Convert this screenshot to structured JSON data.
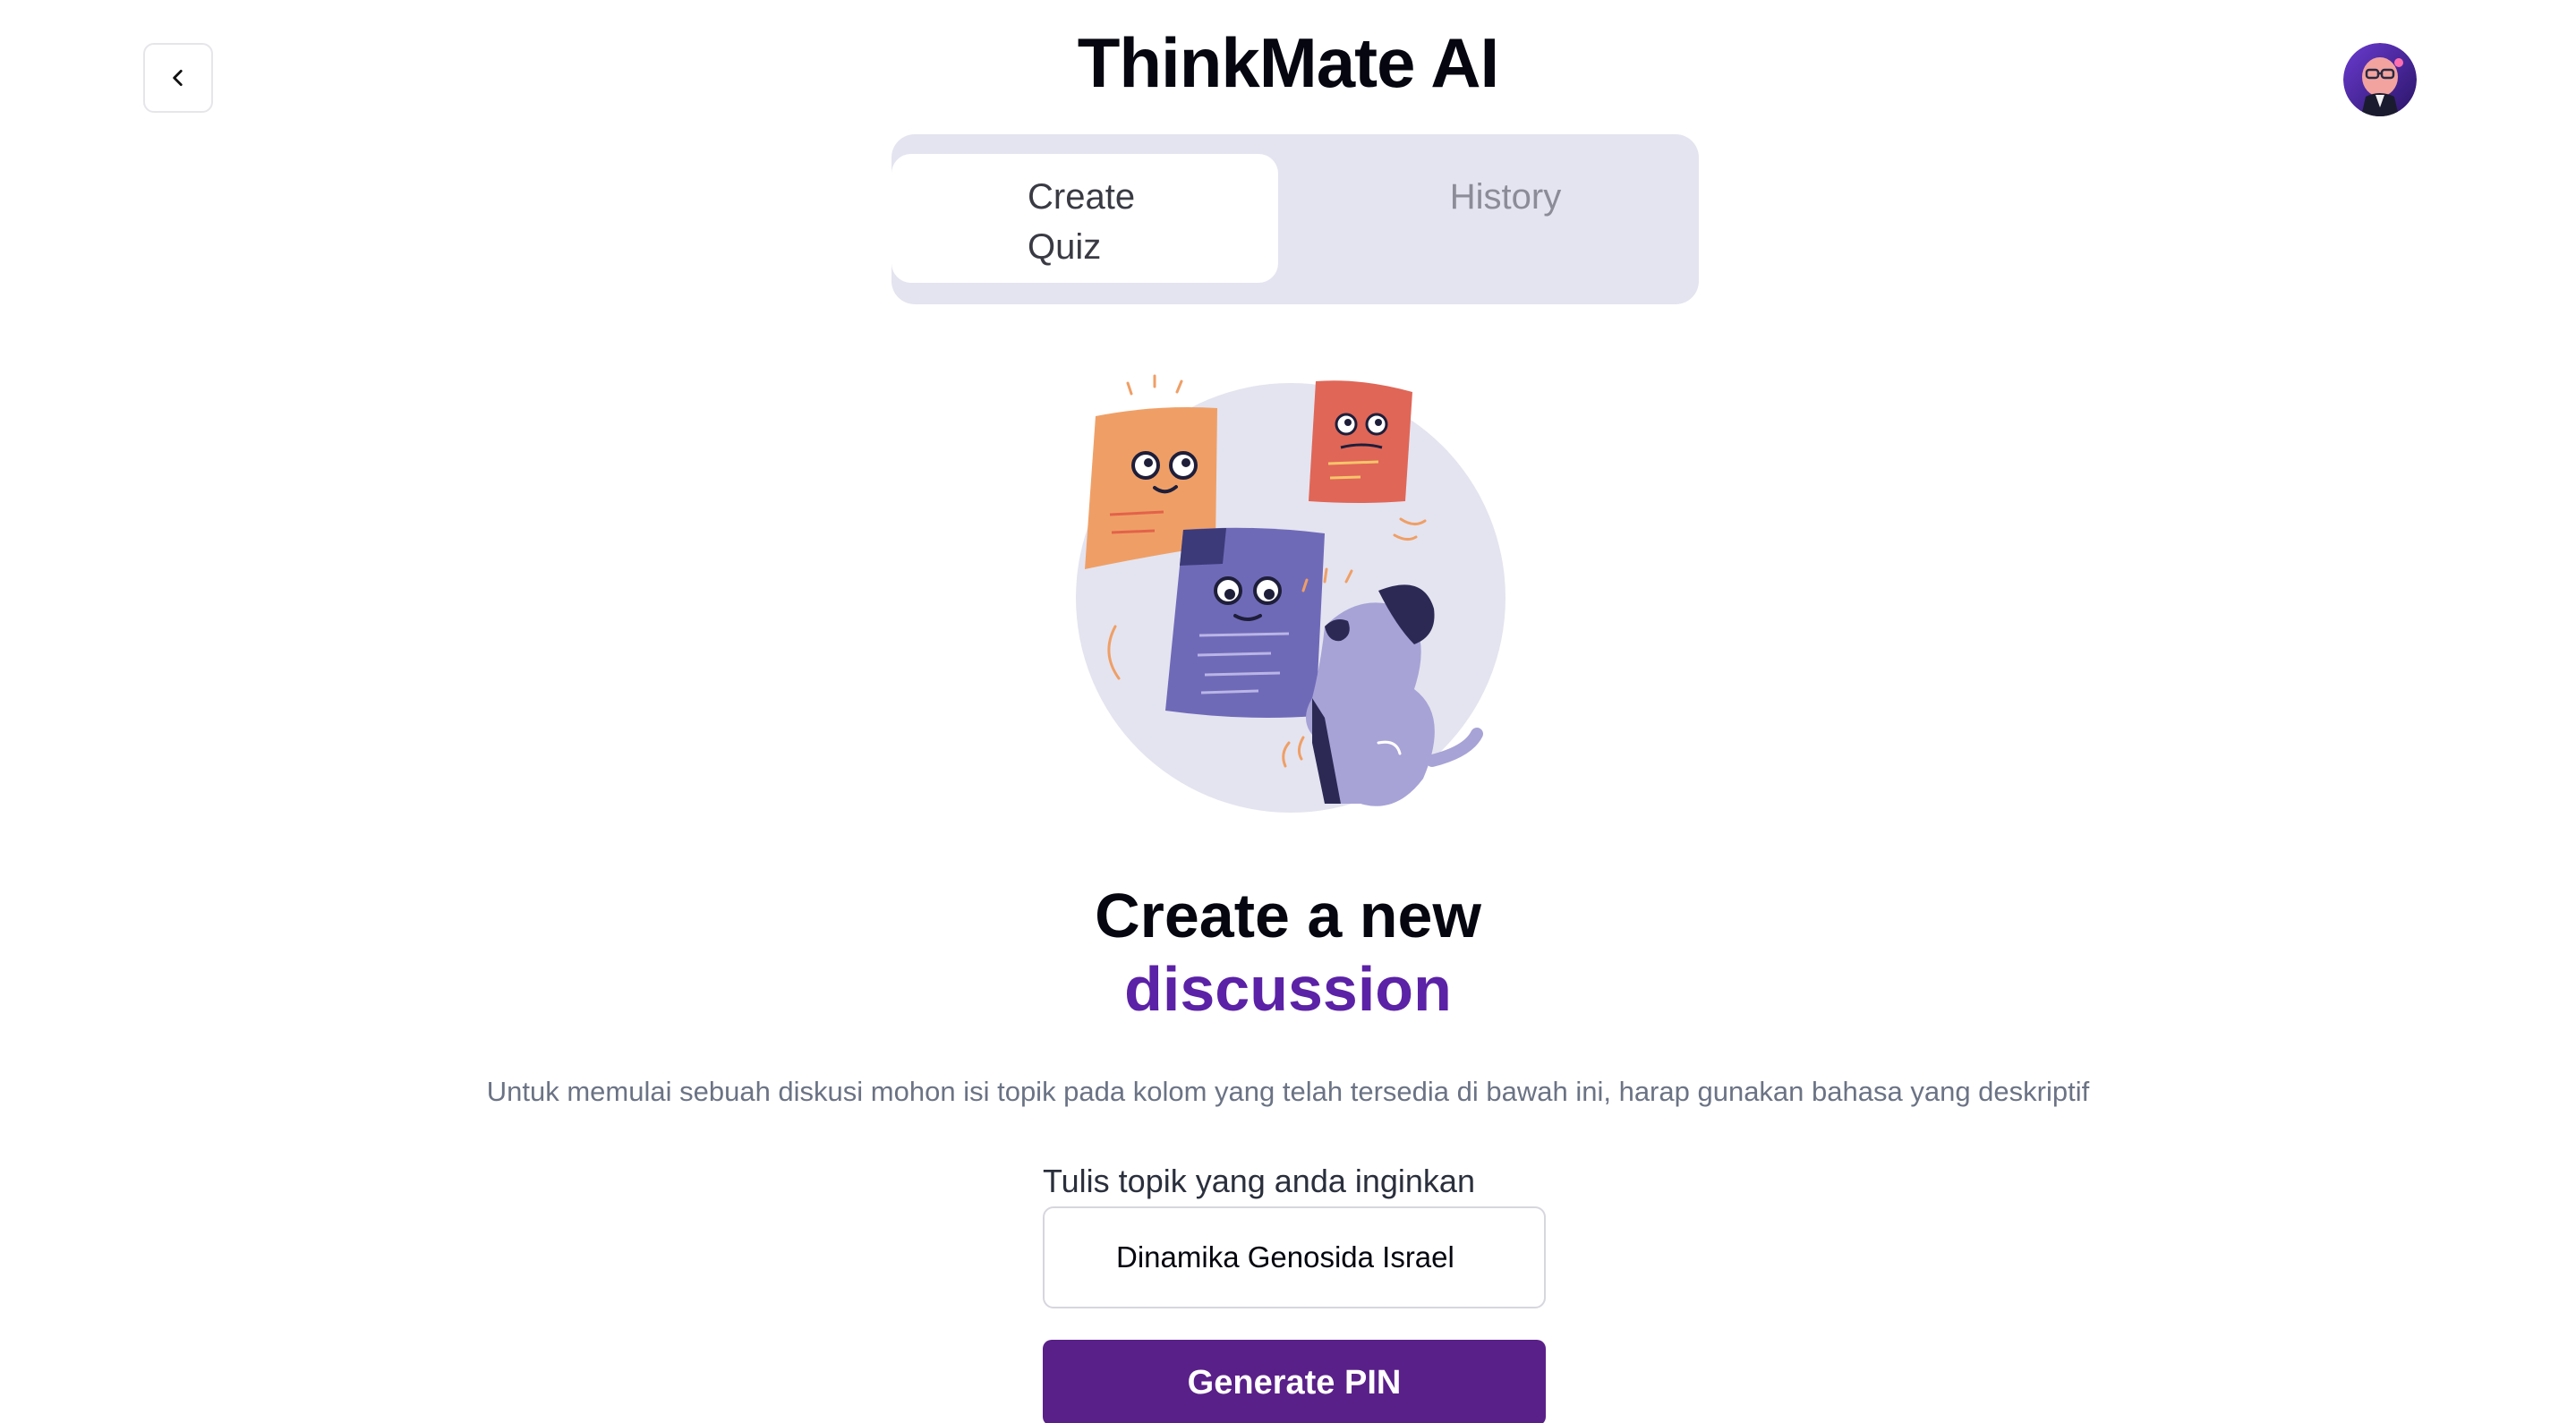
{
  "header": {
    "title": "ThinkMate AI",
    "back_icon": "chevron-left-icon",
    "avatar": "user-avatar"
  },
  "tabs": [
    {
      "label": "Create Quiz",
      "active": true
    },
    {
      "label": "History",
      "active": false
    }
  ],
  "illustration": "sticky-notes-and-dog-illustration",
  "main": {
    "heading_line1": "Create a new",
    "heading_line2": "discussion",
    "description": "Untuk memulai sebuah diskusi mohon isi topik pada kolom yang telah tersedia di bawah ini, harap gunakan bahasa yang deskriptif",
    "field_label": "Tulis topik yang anda inginkan",
    "topic_value": "Dinamika Genosida Israel",
    "button_label": "Generate PIN"
  },
  "colors": {
    "accent": "#5b21a6",
    "button": "#5a2089",
    "tab_track": "#e4e4f0"
  }
}
